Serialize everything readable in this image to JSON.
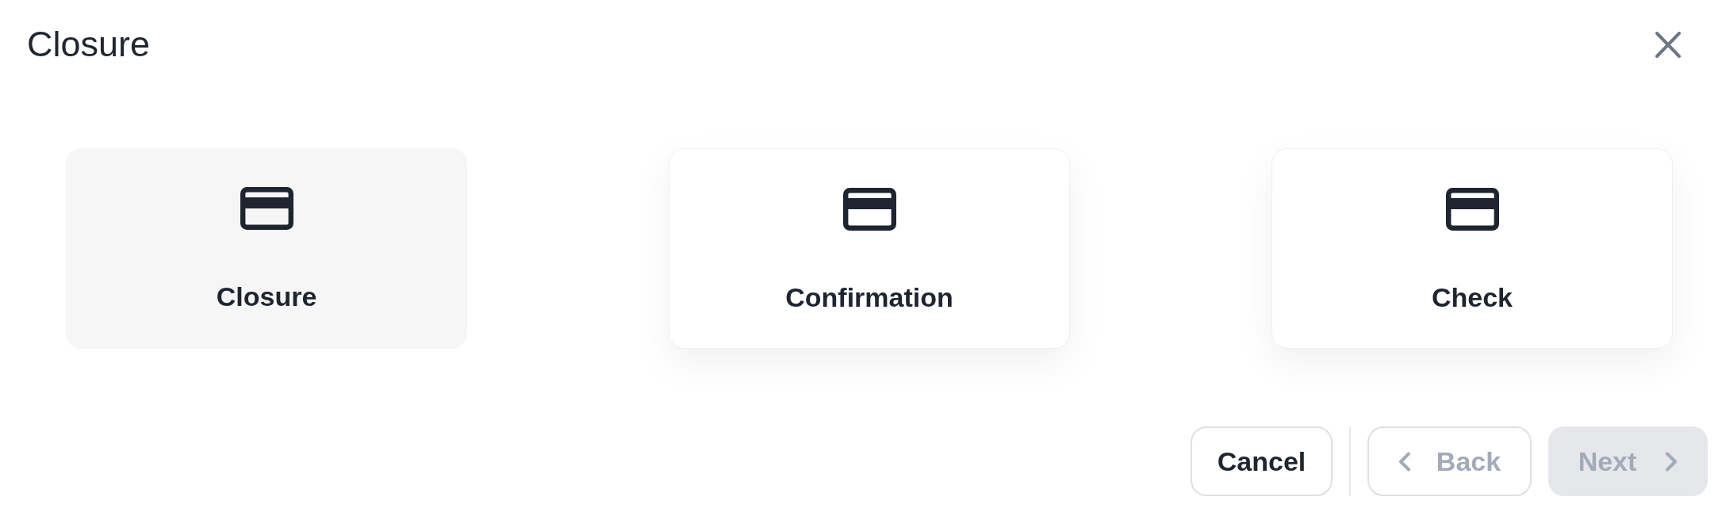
{
  "dialog": {
    "title": "Closure"
  },
  "options": [
    {
      "label": "Closure",
      "selected": true
    },
    {
      "label": "Confirmation",
      "selected": false
    },
    {
      "label": "Check",
      "selected": false
    }
  ],
  "buttons": [
    {
      "kind": "cancel",
      "label": "Cancel",
      "disabled": false
    },
    {
      "kind": "back",
      "label": "Back",
      "disabled": true
    },
    {
      "kind": "next",
      "label": "Next",
      "disabled": true
    }
  ]
}
